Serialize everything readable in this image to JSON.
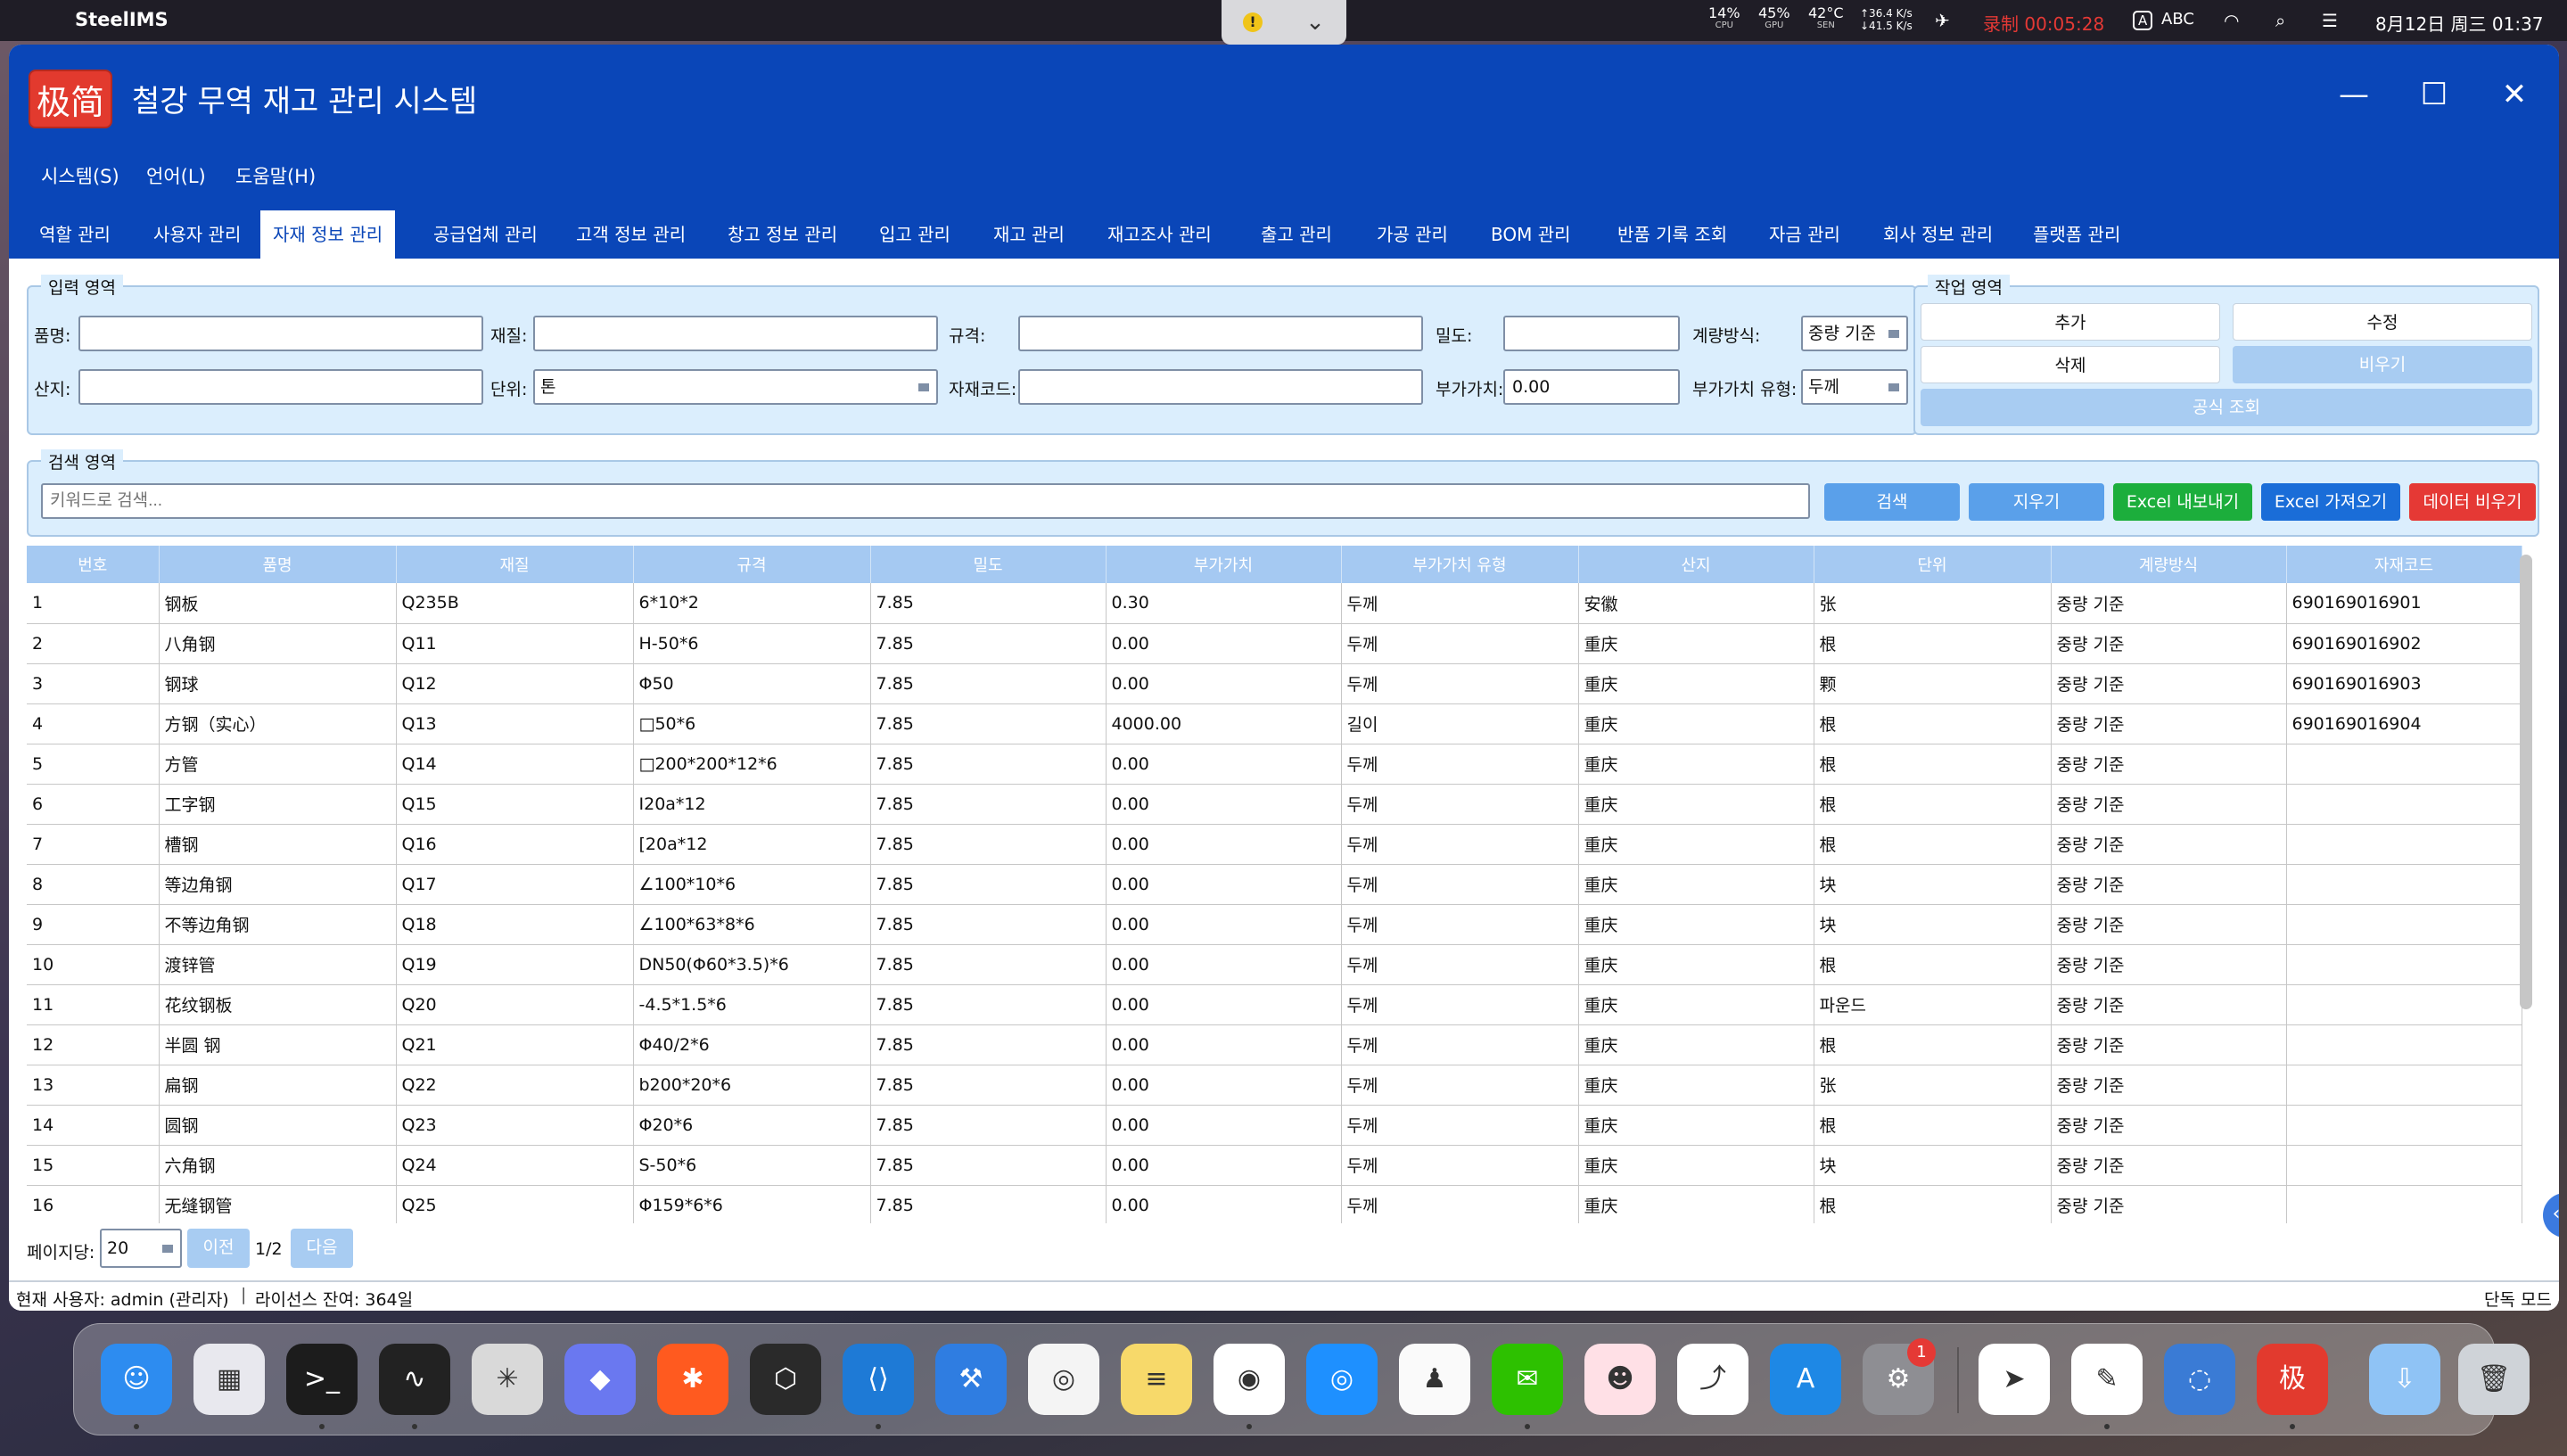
{
  "menubar": {
    "app_name": "SteelIMS",
    "cpu": "14%",
    "cpu_label": "CPU",
    "gpu": "45%",
    "gpu_label": "GPU",
    "temp": "42°C",
    "temp_label": "SEN",
    "net_up": "↑36.4 K/s",
    "net_down": "↓41.5 K/s",
    "recording": "录制 00:05:28",
    "input_source": "ABC",
    "datetime": "8月12日 周三 01:37"
  },
  "window": {
    "logo_text": "极简",
    "title": "철강 무역 재고 관리 시스템"
  },
  "menus": [
    "시스템(S)",
    "언어(L)",
    "도움말(H)"
  ],
  "tabs": [
    "역할 관리",
    "사용자 관리",
    "자재 정보 관리",
    "공급업체 관리",
    "고객 정보 관리",
    "창고 정보 관리",
    "입고 관리",
    "재고 관리",
    "재고조사 관리",
    "출고 관리",
    "가공 관리",
    "BOM 관리",
    "반품 기록 조회",
    "자금 관리",
    "회사 정보 관리",
    "플랫폼 관리"
  ],
  "input_area": {
    "title": "입력 영역",
    "name_label": "품명:",
    "name_value": "",
    "material_label": "재질:",
    "material_value": "",
    "spec_label": "규격:",
    "spec_value": "",
    "density_label": "밀도:",
    "density_value": "",
    "measure_label": "계량방식:",
    "measure_value": "중량 기준",
    "origin_label": "산지:",
    "origin_value": "",
    "unit_label": "단위:",
    "unit_value": "톤",
    "code_label": "자재코드:",
    "code_value": "",
    "added_value_label": "부가가치:",
    "added_value_value": "0.00",
    "added_type_label": "부가가치 유형:",
    "added_type_value": "두께"
  },
  "action_area": {
    "title": "작업 영역",
    "add": "추가",
    "edit": "수정",
    "delete": "삭제",
    "clear": "비우기",
    "formula": "공식 조회"
  },
  "search_area": {
    "title": "검색 영역",
    "placeholder": "키워드로 검색...",
    "search": "검색",
    "reset": "지우기",
    "export": "Excel 내보내기",
    "import": "Excel 가져오기",
    "clear_data": "데이터 비우기"
  },
  "table": {
    "headers": [
      "번호",
      "품명",
      "재질",
      "규격",
      "밀도",
      "부가가치",
      "부가가치 유형",
      "산지",
      "단위",
      "계량방식",
      "자재코드"
    ],
    "rows": [
      [
        "1",
        "钢板",
        "Q235B",
        "6*10*2",
        "7.85",
        "0.30",
        "두께",
        "安徽",
        "张",
        "중량 기준",
        "690169016901"
      ],
      [
        "2",
        "八角钢",
        "Q11",
        "H-50*6",
        "7.85",
        "0.00",
        "두께",
        "重庆",
        "根",
        "중량 기준",
        "690169016902"
      ],
      [
        "3",
        "钢球",
        "Q12",
        "Φ50",
        "7.85",
        "0.00",
        "두께",
        "重庆",
        "颗",
        "중량 기준",
        "690169016903"
      ],
      [
        "4",
        "方钢（实心）",
        "Q13",
        "□50*6",
        "7.85",
        "4000.00",
        "길이",
        "重庆",
        "根",
        "중량 기준",
        "690169016904"
      ],
      [
        "5",
        "方管",
        "Q14",
        "□200*200*12*6",
        "7.85",
        "0.00",
        "두께",
        "重庆",
        "根",
        "중량 기준",
        ""
      ],
      [
        "6",
        "工字钢",
        "Q15",
        "I20a*12",
        "7.85",
        "0.00",
        "두께",
        "重庆",
        "根",
        "중량 기준",
        ""
      ],
      [
        "7",
        "槽钢",
        "Q16",
        "[20a*12",
        "7.85",
        "0.00",
        "두께",
        "重庆",
        "根",
        "중량 기준",
        ""
      ],
      [
        "8",
        "等边角钢",
        "Q17",
        "∠100*10*6",
        "7.85",
        "0.00",
        "두께",
        "重庆",
        "块",
        "중량 기준",
        ""
      ],
      [
        "9",
        "不等边角钢",
        "Q18",
        "∠100*63*8*6",
        "7.85",
        "0.00",
        "두께",
        "重庆",
        "块",
        "중량 기준",
        ""
      ],
      [
        "10",
        "渡锌管",
        "Q19",
        "DN50(Φ60*3.5)*6",
        "7.85",
        "0.00",
        "두께",
        "重庆",
        "根",
        "중량 기준",
        ""
      ],
      [
        "11",
        "花纹钢板",
        "Q20",
        "-4.5*1.5*6",
        "7.85",
        "0.00",
        "두께",
        "重庆",
        "파운드",
        "중량 기준",
        ""
      ],
      [
        "12",
        "半圆 钢",
        "Q21",
        "Φ40/2*6",
        "7.85",
        "0.00",
        "두께",
        "重庆",
        "根",
        "중량 기준",
        ""
      ],
      [
        "13",
        "扁钢",
        "Q22",
        "b200*20*6",
        "7.85",
        "0.00",
        "두께",
        "重庆",
        "张",
        "중량 기준",
        ""
      ],
      [
        "14",
        "圆钢",
        "Q23",
        "Φ20*6",
        "7.85",
        "0.00",
        "두께",
        "重庆",
        "根",
        "중량 기준",
        ""
      ],
      [
        "15",
        "六角钢",
        "Q24",
        "S-50*6",
        "7.85",
        "0.00",
        "두께",
        "重庆",
        "块",
        "중량 기준",
        ""
      ],
      [
        "16",
        "无缝钢管",
        "Q25",
        "Φ159*6*6",
        "7.85",
        "0.00",
        "두께",
        "重庆",
        "根",
        "중량 기준",
        ""
      ]
    ]
  },
  "pagination": {
    "per_page_label": "페이지당:",
    "per_page_value": "20",
    "prev": "이전",
    "page_info": "1/2",
    "next": "다음"
  },
  "status": {
    "user": "현재 사용자: admin (관리자)",
    "license": "라이선스 잔여: 364일",
    "mode": "단독 모드"
  },
  "dock": {
    "apps": [
      "Finder",
      "Launchpad",
      "Terminal",
      "Activity Monitor",
      "Claude",
      "Copilot",
      "Perplexity",
      "Cursor",
      "VS Code",
      "Xcode",
      "Baidu Netdisk",
      "Notes",
      "Chrome",
      "Safari",
      "QQ",
      "WeChat",
      "Avatar",
      "Lark",
      "App Store",
      "System Settings",
      "DingTalk",
      "TextEdit",
      "Loupe",
      "SteelIMS",
      "Downloads",
      "Trash"
    ],
    "settings_badge": "1"
  }
}
